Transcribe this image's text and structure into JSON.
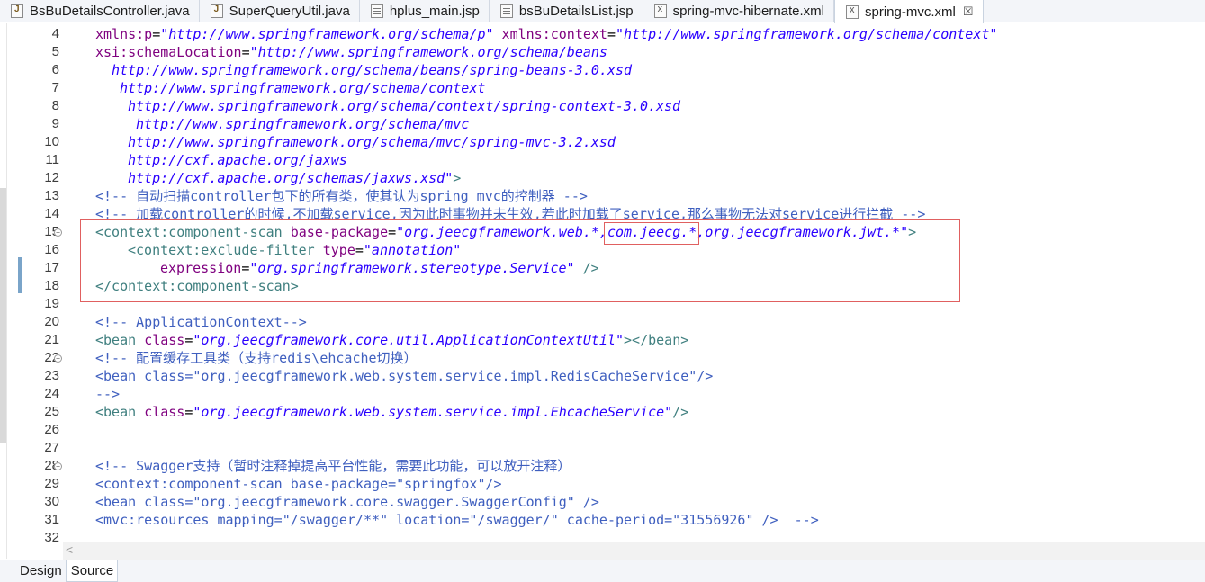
{
  "tabs": [
    {
      "label": "BsBuDetailsController.java",
      "icon": "java-file-icon"
    },
    {
      "label": "SuperQueryUtil.java",
      "icon": "java-file-icon"
    },
    {
      "label": "hplus_main.jsp",
      "icon": "jsp-file-icon"
    },
    {
      "label": "bsBuDetailsList.jsp",
      "icon": "jsp-file-icon"
    },
    {
      "label": "spring-mvc-hibernate.xml",
      "icon": "xml-file-icon"
    },
    {
      "label": "spring-mvc.xml",
      "icon": "xml-file-icon",
      "close": "☒"
    }
  ],
  "editor": {
    "lines": [
      {
        "n": "4",
        "indent": 98,
        "parts": [
          [
            "a",
            "xmlns:p"
          ],
          [
            "k",
            "="
          ],
          [
            "v",
            "\"http://www.springframework.org/schema/p\""
          ],
          [
            "k",
            " "
          ],
          [
            "a",
            "xmlns:context"
          ],
          [
            "k",
            "="
          ],
          [
            "v",
            "\"http://www.springframework.org/schema/context\""
          ]
        ]
      },
      {
        "n": "5",
        "indent": 98,
        "parts": [
          [
            "a",
            "xsi:schemaLocation"
          ],
          [
            "k",
            "="
          ],
          [
            "v",
            "\"http://www.springframework.org/schema/beans"
          ]
        ]
      },
      {
        "n": "6",
        "indent": 116,
        "parts": [
          [
            "v",
            "http://www.springframework.org/schema/beans/spring-beans-3.0.xsd"
          ]
        ]
      },
      {
        "n": "7",
        "indent": 125,
        "parts": [
          [
            "v",
            "http://www.springframework.org/schema/context"
          ]
        ]
      },
      {
        "n": "8",
        "indent": 134,
        "parts": [
          [
            "v",
            "http://www.springframework.org/schema/context/spring-context-3.0.xsd"
          ]
        ]
      },
      {
        "n": "9",
        "indent": 143,
        "parts": [
          [
            "v",
            "http://www.springframework.org/schema/mvc"
          ]
        ]
      },
      {
        "n": "10",
        "indent": 134,
        "parts": [
          [
            "v",
            "http://www.springframework.org/schema/mvc/spring-mvc-3.2.xsd"
          ]
        ]
      },
      {
        "n": "11",
        "indent": 134,
        "parts": [
          [
            "v",
            "http://cxf.apache.org/jaxws"
          ]
        ]
      },
      {
        "n": "12",
        "indent": 134,
        "parts": [
          [
            "v",
            "http://cxf.apache.org/schemas/jaxws.xsd\""
          ],
          [
            "t",
            ">"
          ]
        ]
      },
      {
        "n": "13",
        "indent": 98,
        "parts": [
          [
            "c",
            "<!-- 自动扫描controller包下的所有类，使其认为spring mvc的控制器 -->"
          ]
        ]
      },
      {
        "n": "14",
        "indent": 98,
        "parts": [
          [
            "c",
            "<!-- 加载controller的时候,不加载service,因为此时事物并未生效,若此时加载了service,那么事物无法对service进行拦截 -->"
          ]
        ]
      },
      {
        "n": "15",
        "indent": 98,
        "fold": "−",
        "parts": [
          [
            "t",
            "<context:component-scan"
          ],
          [
            "k",
            " "
          ],
          [
            "a",
            "base-package"
          ],
          [
            "k",
            "="
          ],
          [
            "v",
            "\"org.jeecgframework.web.*,com.jeecg.*,org.jeecgframework.jwt.*\""
          ],
          [
            "t",
            ">"
          ]
        ]
      },
      {
        "n": "16",
        "indent": 134,
        "parts": [
          [
            "t",
            "<context:exclude-filter"
          ],
          [
            "k",
            " "
          ],
          [
            "a",
            "type"
          ],
          [
            "k",
            "="
          ],
          [
            "v",
            "\"annotation\""
          ]
        ]
      },
      {
        "n": "17",
        "indent": 170,
        "parts": [
          [
            "a",
            "expression"
          ],
          [
            "k",
            "="
          ],
          [
            "v",
            "\"org.springframework.stereotype.Service\""
          ],
          [
            "k",
            " "
          ],
          [
            "t",
            "/>"
          ]
        ]
      },
      {
        "n": "18",
        "indent": 98,
        "parts": [
          [
            "t",
            "</context:component-scan>"
          ]
        ]
      },
      {
        "n": "19",
        "indent": 98,
        "parts": []
      },
      {
        "n": "20",
        "indent": 98,
        "parts": [
          [
            "c",
            "<!-- ApplicationContext-->"
          ]
        ]
      },
      {
        "n": "21",
        "indent": 98,
        "parts": [
          [
            "t",
            "<bean"
          ],
          [
            "k",
            " "
          ],
          [
            "a",
            "class"
          ],
          [
            "k",
            "="
          ],
          [
            "v",
            "\"org.jeecgframework.core.util.ApplicationContextUtil\""
          ],
          [
            "t",
            "></bean>"
          ]
        ]
      },
      {
        "n": "22",
        "indent": 98,
        "fold": "−",
        "parts": [
          [
            "c",
            "<!-- 配置缓存工具类（支持redis\\ehcache切换）"
          ]
        ]
      },
      {
        "n": "23",
        "indent": 98,
        "parts": [
          [
            "c",
            "<bean class=\"org.jeecgframework.web.system.service.impl.RedisCacheService\"/>"
          ]
        ]
      },
      {
        "n": "24",
        "indent": 98,
        "parts": [
          [
            "c",
            "-->"
          ]
        ]
      },
      {
        "n": "25",
        "indent": 98,
        "parts": [
          [
            "t",
            "<bean"
          ],
          [
            "k",
            " "
          ],
          [
            "a",
            "class"
          ],
          [
            "k",
            "="
          ],
          [
            "v",
            "\"org.jeecgframework.web.system.service.impl.EhcacheService\""
          ],
          [
            "t",
            "/>"
          ]
        ]
      },
      {
        "n": "26",
        "indent": 98,
        "parts": []
      },
      {
        "n": "27",
        "indent": 98,
        "parts": []
      },
      {
        "n": "28",
        "indent": 98,
        "fold": "−",
        "parts": [
          [
            "c",
            "<!-- Swagger支持（暂时注释掉提高平台性能，需要此功能，可以放开注释）"
          ]
        ]
      },
      {
        "n": "29",
        "indent": 98,
        "parts": [
          [
            "c",
            "<context:component-scan base-package=\"springfox\"/>"
          ]
        ]
      },
      {
        "n": "30",
        "indent": 98,
        "parts": [
          [
            "c",
            "<bean class=\"org.jeecgframework.core.swagger.SwaggerConfig\" />"
          ]
        ]
      },
      {
        "n": "31",
        "indent": 98,
        "parts": [
          [
            "c",
            "<mvc:resources mapping=\"/swagger/**\" location=\"/swagger/\" cache-period=\"31556926\" />  -->"
          ]
        ]
      },
      {
        "n": "32",
        "indent": 98,
        "parts": []
      }
    ]
  },
  "scroll": {
    "left_arrow": "<"
  },
  "bottom_tabs": [
    {
      "label": "Design"
    },
    {
      "label": "Source",
      "active": true
    }
  ],
  "colors": {
    "tag": "#3f7f7f",
    "attribute": "#7f007f",
    "value": "#2a00ff",
    "comment": "#3f5fbf",
    "highlight_box": "#e06060"
  }
}
